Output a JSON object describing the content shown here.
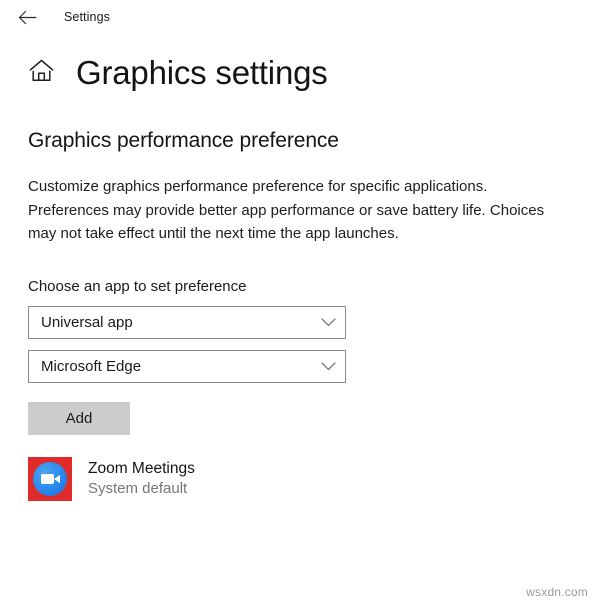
{
  "titlebar": {
    "back_icon": "back-arrow-icon",
    "label": "Settings"
  },
  "header": {
    "home_icon": "home-icon",
    "title": "Graphics settings"
  },
  "main": {
    "section_heading": "Graphics performance preference",
    "description": "Customize graphics performance preference for specific applications. Preferences may provide better app performance or save battery life. Choices may not take effect until the next time the app launches.",
    "field_label": "Choose an app to set preference",
    "app_type_dropdown": {
      "value": "Universal app",
      "chevron_icon": "chevron-down-icon"
    },
    "app_name_dropdown": {
      "value": "Microsoft Edge",
      "chevron_icon": "chevron-down-icon"
    },
    "add_button_label": "Add",
    "app_list": [
      {
        "icon": "zoom-meetings-icon",
        "name": "Zoom Meetings",
        "status": "System default"
      }
    ]
  },
  "watermark": "wsxdn.com",
  "colors": {
    "page_background": "#ffffff",
    "text_primary": "#1a1a1a",
    "text_secondary": "#767676",
    "dropdown_border": "#8a8a8a",
    "button_background": "#cccccc",
    "zoom_icon_red": "#e02b2b",
    "zoom_icon_blue": "#2d8cf0"
  }
}
